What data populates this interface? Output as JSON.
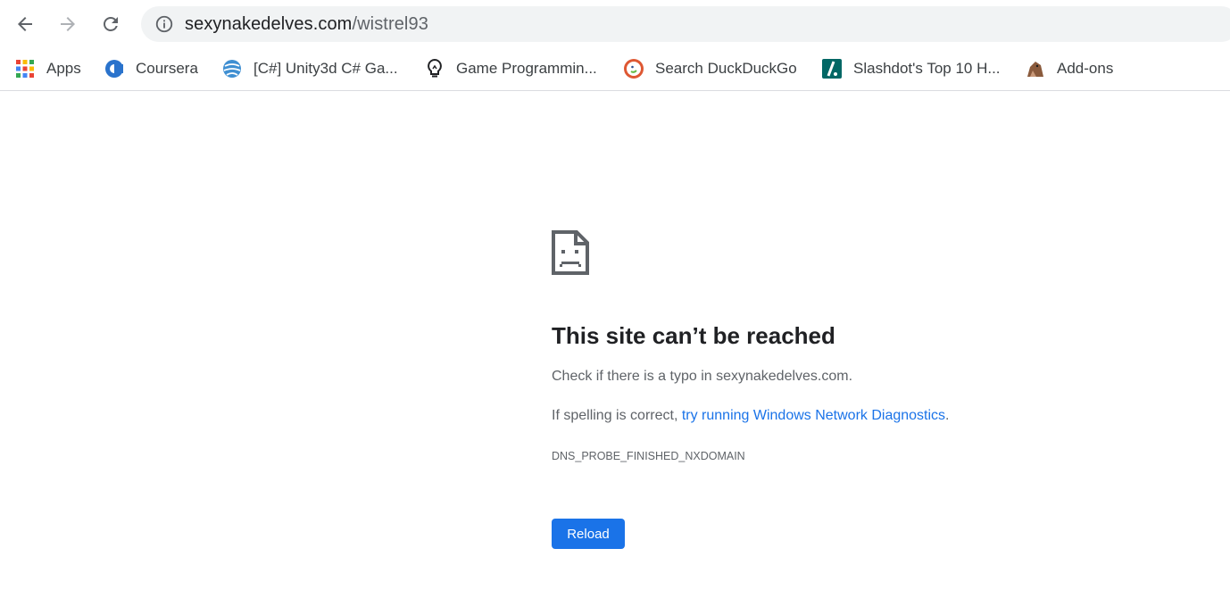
{
  "toolbar": {
    "back_icon": "arrow-left-icon",
    "forward_icon": "arrow-right-icon",
    "reload_icon": "reload-icon",
    "info_icon": "info-icon",
    "url_host": "sexynakedelves.com",
    "url_path": "/wistrel93"
  },
  "bookmarks": [
    {
      "label": "Apps",
      "icon": "apps-grid-icon"
    },
    {
      "label": "Coursera",
      "icon": "coursera-icon"
    },
    {
      "label": "[C#] Unity3d C# Ga...",
      "icon": "unity-globe-icon"
    },
    {
      "label": "Game Programmin...",
      "icon": "lightbulb-icon"
    },
    {
      "label": "Search DuckDuckGo",
      "icon": "duckduckgo-icon"
    },
    {
      "label": "Slashdot's Top 10 H...",
      "icon": "slashdot-icon"
    },
    {
      "label": "Add-ons",
      "icon": "add-ons-icon"
    }
  ],
  "error": {
    "icon": "sad-document-icon",
    "title": "This site can’t be reached",
    "line1": "Check if there is a typo in sexynakedelves.com.",
    "line2_prefix": "If spelling is correct, ",
    "line2_link": "try running Windows Network Diagnostics",
    "line2_suffix": ".",
    "code": "DNS_PROBE_FINISHED_NXDOMAIN",
    "reload_label": "Reload"
  },
  "colors": {
    "accent": "#1a73e8",
    "omnibox_bg": "#f1f3f4",
    "text_secondary": "#5f6368"
  }
}
